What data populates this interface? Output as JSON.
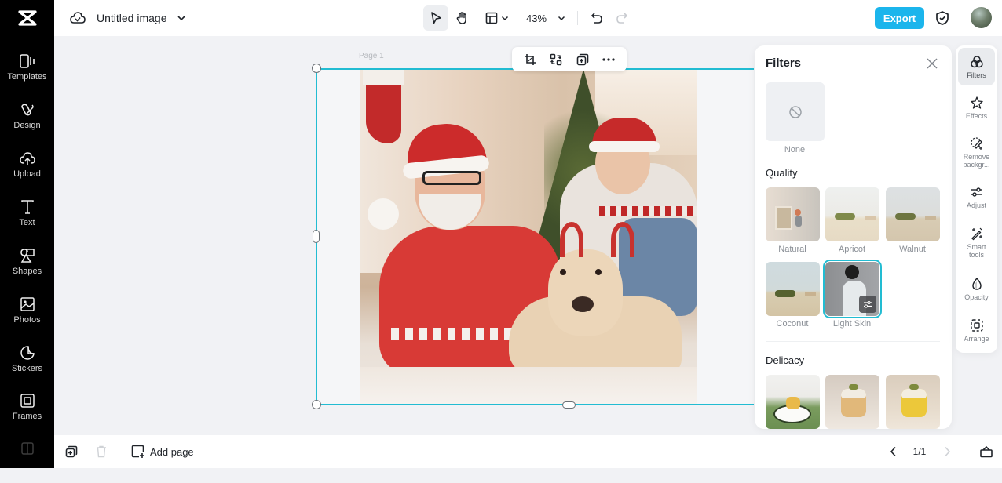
{
  "app": {
    "title": "Untitled image",
    "brand_color": "#1bb5ec",
    "selection_color": "#22bcd2"
  },
  "sidebar": {
    "logo_icon": "capcut-logo-icon",
    "items": [
      {
        "label": "Templates",
        "icon": "templates-icon"
      },
      {
        "label": "Design",
        "icon": "design-icon"
      },
      {
        "label": "Upload",
        "icon": "upload-icon"
      },
      {
        "label": "Text",
        "icon": "text-icon"
      },
      {
        "label": "Shapes",
        "icon": "shapes-icon"
      },
      {
        "label": "Photos",
        "icon": "photos-icon"
      },
      {
        "label": "Stickers",
        "icon": "stickers-icon"
      },
      {
        "label": "Frames",
        "icon": "frames-icon"
      }
    ]
  },
  "topbar": {
    "cloud_icon": "cloud-check-icon",
    "zoom": "43%",
    "export_label": "Export",
    "tools": [
      "select-tool",
      "hand-tool",
      "layout-tool",
      "undo",
      "redo"
    ]
  },
  "canvas": {
    "page_label": "Page 1",
    "float_toolbar": [
      "crop-icon",
      "replace-icon",
      "duplicate-icon",
      "more-icon"
    ]
  },
  "filters_panel": {
    "title": "Filters",
    "none_label": "None",
    "sections": [
      {
        "title": "Quality",
        "items": [
          {
            "label": "Natural"
          },
          {
            "label": "Apricot"
          },
          {
            "label": "Walnut"
          },
          {
            "label": "Coconut"
          },
          {
            "label": "Light Skin",
            "selected": true
          }
        ]
      },
      {
        "title": "Delicacy",
        "items": [
          {
            "label": ""
          },
          {
            "label": ""
          },
          {
            "label": ""
          }
        ]
      }
    ]
  },
  "right_rail": {
    "items": [
      {
        "label": "Filters",
        "active": true
      },
      {
        "label": "Effects"
      },
      {
        "label": "Remove backgr..."
      },
      {
        "label": "Adjust"
      },
      {
        "label": "Smart tools"
      },
      {
        "label": "Opacity"
      },
      {
        "label": "Arrange"
      }
    ]
  },
  "bottombar": {
    "add_page_label": "Add page",
    "page_counter": "1/1"
  }
}
